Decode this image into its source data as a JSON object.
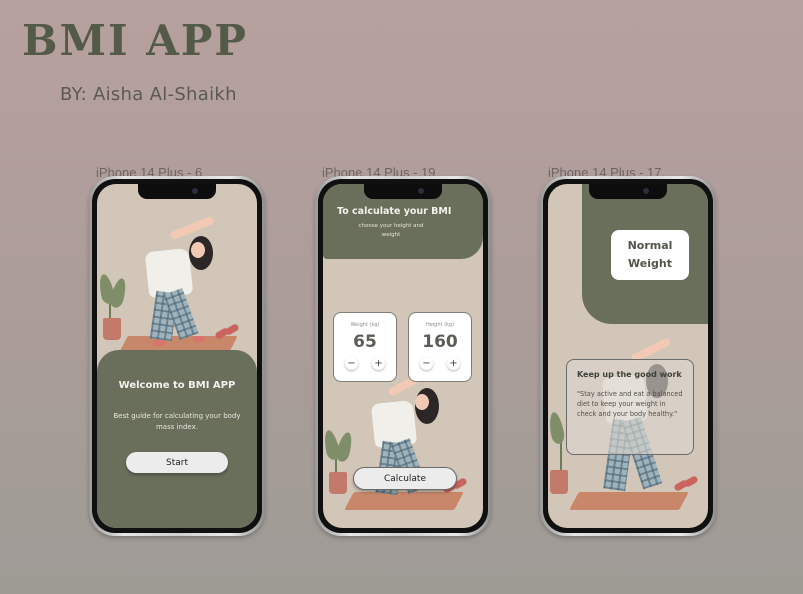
{
  "header": {
    "app_title": "BMI APP",
    "byline": "BY: Aisha Al-Shaikh"
  },
  "frames": [
    {
      "label": "iPhone 14 Plus - 6"
    },
    {
      "label": "iPhone 14 Plus - 19"
    },
    {
      "label": "iPhone 14 Plus - 17"
    }
  ],
  "screen1": {
    "title": "Welcome to BMI APP",
    "subtitle": "Best guide for calculating your body mass index.",
    "start_label": "Start"
  },
  "screen2": {
    "title": "To calculate your BMI",
    "subtitle": "choose your height and weight",
    "weight": {
      "label": "Weight (kg)",
      "value": "65"
    },
    "height": {
      "label": "Height (kg)",
      "value": "160"
    },
    "minus": "−",
    "plus": "+",
    "calculate_label": "Calculate"
  },
  "screen3": {
    "result": "Normal Weight",
    "message_title": "Keep up the good work",
    "message_body": "\"Stay active and eat a balanced diet to keep your weight in check and your body healthy.\""
  },
  "colors": {
    "primary_green": "#6a6f5c",
    "screen_bg": "#d2c6b8",
    "title_color": "#545a48"
  }
}
